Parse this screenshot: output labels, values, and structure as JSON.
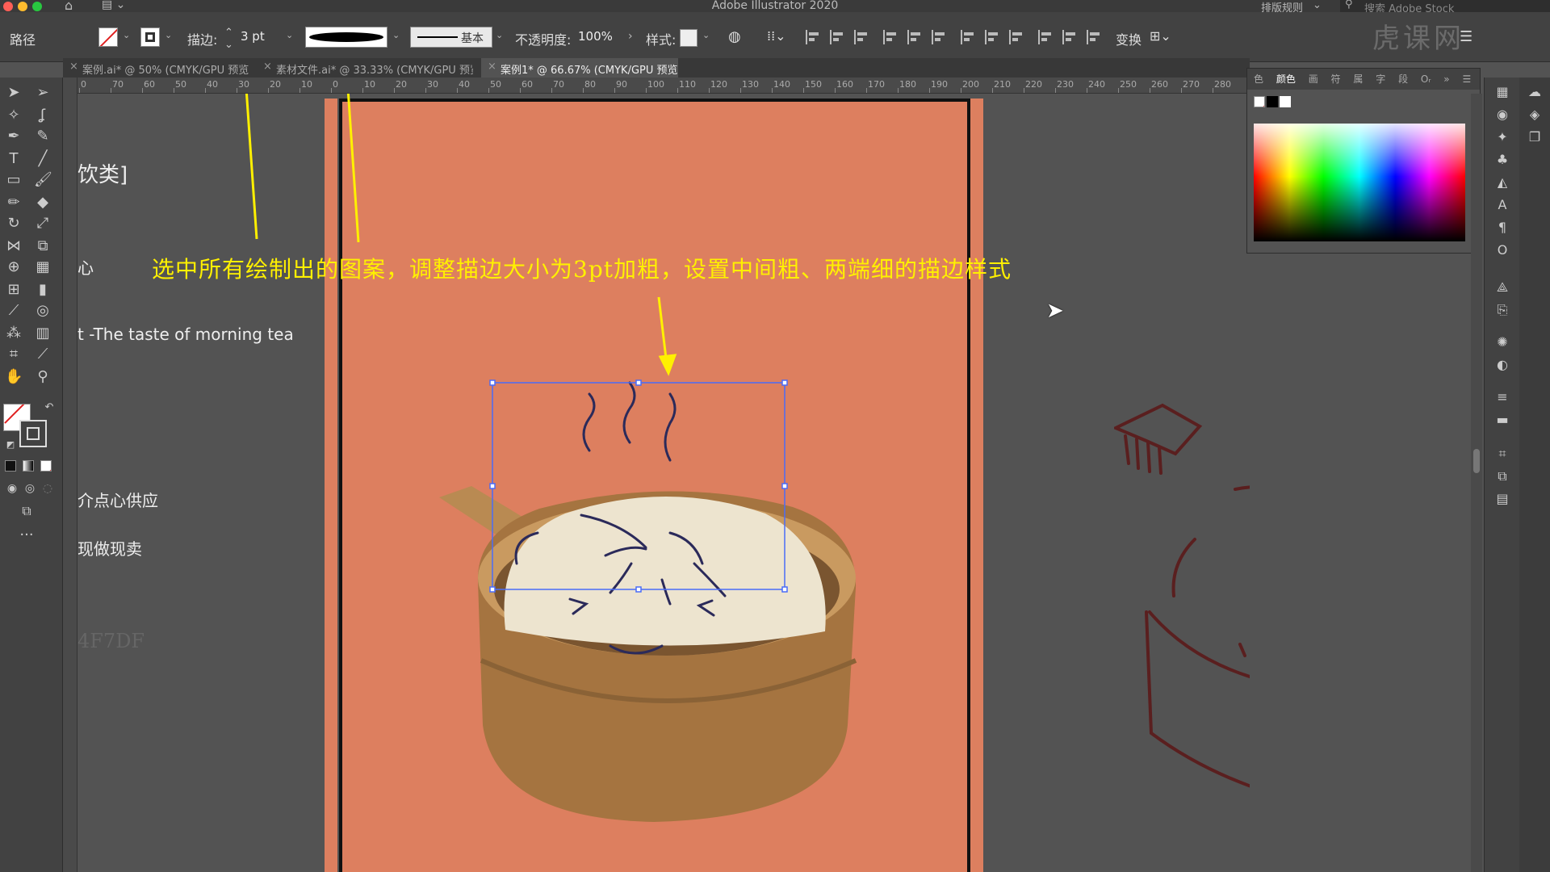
{
  "titlebar": {
    "app_title": "Adobe Illustrator 2020",
    "workspace_label": "排版规则",
    "search_placeholder": "搜索 Adobe Stock",
    "traffic_colors": [
      "#ff5f57",
      "#febc2e",
      "#28c840"
    ]
  },
  "controlbar": {
    "selection_label": "路径",
    "stroke_label": "描边:",
    "stroke_value": "3 pt",
    "profile_label": "基本",
    "opacity_label": "不透明度:",
    "opacity_value": "100%",
    "style_label": "样式:",
    "transform_label": "变换"
  },
  "tabs": [
    {
      "label": "案例.ai* @ 50% (CMYK/GPU 预览)"
    },
    {
      "label": "素材文件.ai* @ 33.33% (CMYK/GPU 预览)"
    },
    {
      "label": "案例1* @ 66.67% (CMYK/GPU 预览)"
    }
  ],
  "ruler": {
    "labels": [
      "0",
      "70",
      "60",
      "50",
      "40",
      "30",
      "20",
      "10",
      "0",
      "10",
      "20",
      "30",
      "40",
      "50",
      "60",
      "70",
      "80",
      "90",
      "100",
      "110",
      "120",
      "130",
      "140",
      "150",
      "160",
      "170",
      "180",
      "190",
      "200",
      "210",
      "220",
      "230",
      "240",
      "250",
      "260",
      "270",
      "280"
    ]
  },
  "canvas_text": {
    "line1": "饮类]",
    "line2": "心",
    "line3": "t -The taste of morning tea",
    "line4": "介点心供应",
    "line5": "现做现卖",
    "line6": "4F7DF"
  },
  "annotation": {
    "text": "选中所有绘制出的图案，调整描边大小为3pt加粗，设置中间粗、两端细的描边样式",
    "color": "#fff000"
  },
  "color_panel": {
    "tabs": [
      "色",
      "颜色",
      "画",
      "符",
      "属",
      "字",
      "段",
      "Oᵣ"
    ],
    "active_tab": "颜色"
  },
  "watermark": {
    "text": "虎课网"
  },
  "colors": {
    "artboard": "#dd7f5f",
    "drawing_stroke": "#5a1f1f",
    "selection": "#4a6cf7"
  }
}
